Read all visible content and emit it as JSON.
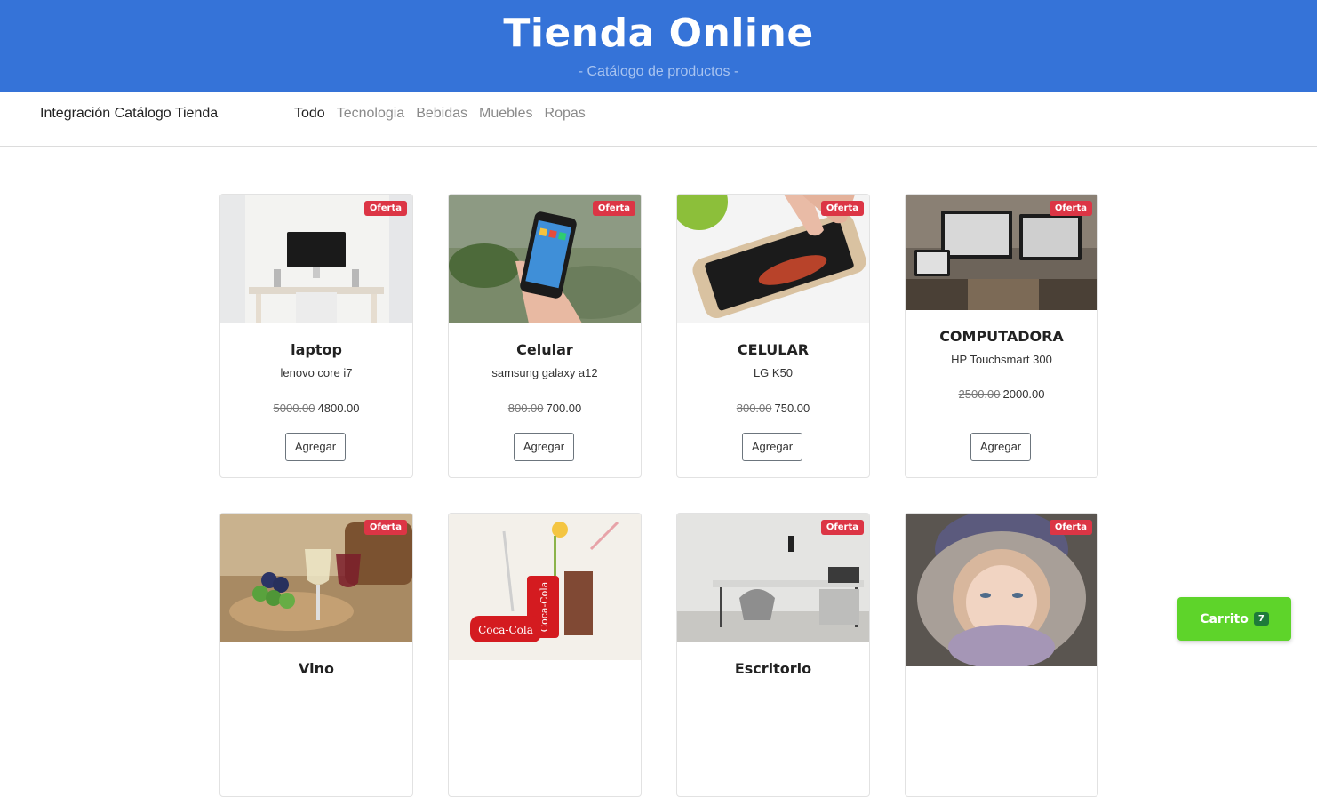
{
  "header": {
    "title": "Tienda Online",
    "subtitle": "- Catálogo de productos -"
  },
  "navbar": {
    "brand": "Integración Catálogo Tienda",
    "items": [
      {
        "label": "Todo",
        "active": true
      },
      {
        "label": "Tecnologia",
        "active": false
      },
      {
        "label": "Bebidas",
        "active": false
      },
      {
        "label": "Muebles",
        "active": false
      },
      {
        "label": "Ropas",
        "active": false
      }
    ]
  },
  "products": [
    {
      "name": "laptop",
      "description": "lenovo core i7",
      "old_price": "5000.00",
      "price": "4800.00",
      "badge": "Oferta",
      "button": "Agregar",
      "image": "laptop-desk"
    },
    {
      "name": "Celular",
      "description": "samsung galaxy a12",
      "old_price": "800.00",
      "price": "700.00",
      "badge": "Oferta",
      "button": "Agregar",
      "image": "hand-phone"
    },
    {
      "name": "CELULAR",
      "description": "LG K50",
      "old_price": "800.00",
      "price": "750.00",
      "badge": "Oferta",
      "button": "Agregar",
      "image": "phone-touch"
    },
    {
      "name": "COMPUTADORA",
      "description": "HP Touchsmart 300",
      "old_price": "2500.00",
      "price": "2000.00",
      "badge": "Oferta",
      "button": "Agregar",
      "image": "computers-desk"
    },
    {
      "name": "Vino",
      "badge": "Oferta",
      "image": "wine-grapes"
    },
    {
      "name": "",
      "badge": "",
      "image": "coca-cola"
    },
    {
      "name": "Escritorio",
      "badge": "Oferta",
      "image": "office-desk"
    },
    {
      "name": "",
      "badge": "Oferta",
      "image": "girl-winter-hood"
    }
  ],
  "cart": {
    "label": "Carrito",
    "count": "7"
  }
}
